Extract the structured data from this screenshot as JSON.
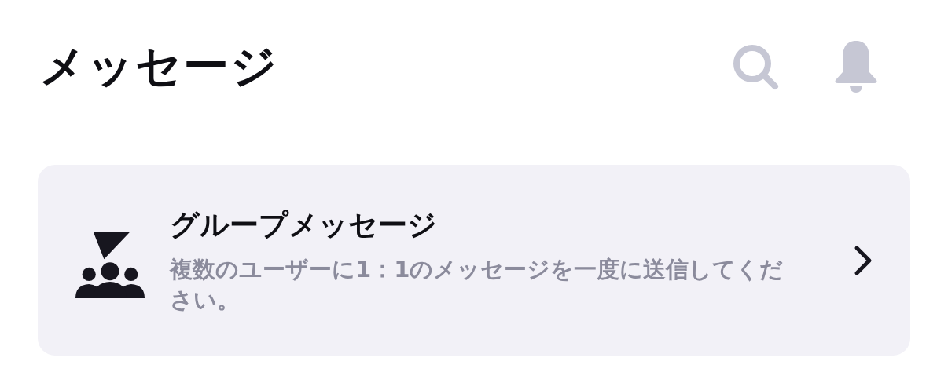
{
  "header": {
    "title": "メッセージ"
  },
  "cards": [
    {
      "title": "グループメッセージ",
      "description": "複数のユーザーに1：1のメッセージを一度に送信してください。"
    }
  ]
}
